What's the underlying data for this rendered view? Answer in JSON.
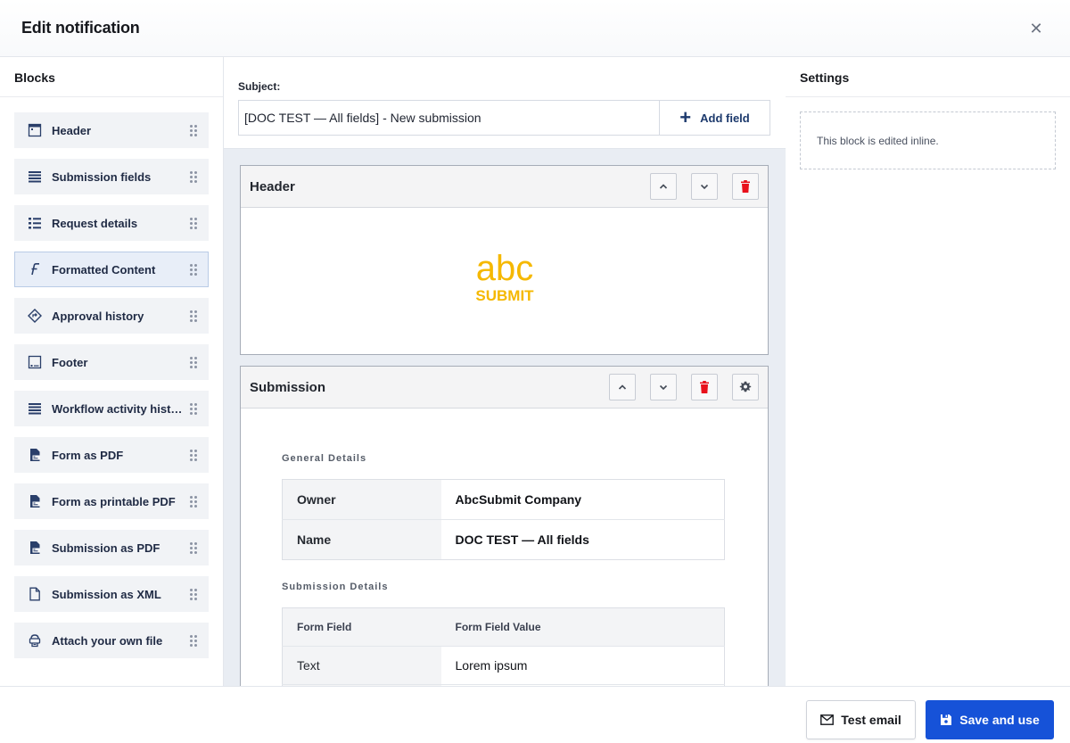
{
  "window": {
    "title": "Edit notification",
    "close_icon": "close-icon"
  },
  "blocks_panel": {
    "title": "Blocks",
    "items": [
      {
        "label": "Header",
        "icon": "header-icon"
      },
      {
        "label": "Submission fields",
        "icon": "list-lines-icon"
      },
      {
        "label": "Request details",
        "icon": "bullet-list-icon"
      },
      {
        "label": "Formatted Content",
        "icon": "formatted-text-icon",
        "active": true
      },
      {
        "label": "Approval history",
        "icon": "approval-diamond-icon"
      },
      {
        "label": "Footer",
        "icon": "footer-icon"
      },
      {
        "label": "Workflow activity history",
        "icon": "list-lines-icon"
      },
      {
        "label": "Form as PDF",
        "icon": "pdf-icon"
      },
      {
        "label": "Form as printable PDF",
        "icon": "pdf-icon"
      },
      {
        "label": "Submission as PDF",
        "icon": "pdf-icon"
      },
      {
        "label": "Submission as XML",
        "icon": "file-icon"
      },
      {
        "label": "Attach your own file",
        "icon": "attach-file-icon"
      }
    ]
  },
  "subject": {
    "label": "Subject:",
    "value": "[DOC TEST — All fields] - New submission",
    "add_field_label": "Add field"
  },
  "canvas": {
    "header_block": {
      "title": "Header",
      "logo_text_top": "abc",
      "logo_text_bottom": "SUBMIT",
      "logo_color": "#F5B800"
    },
    "submission_block": {
      "title": "Submission",
      "general_title": "General Details",
      "general_rows": [
        {
          "key": "Owner",
          "value": "AbcSubmit Company"
        },
        {
          "key": "Name",
          "value": "DOC TEST — All fields"
        }
      ],
      "details_title": "Submission Details",
      "details_header": {
        "col1": "Form Field",
        "col2": "Form Field Value"
      },
      "details_rows": [
        {
          "key": "Text",
          "value": "Lorem ipsum"
        }
      ]
    }
  },
  "settings_panel": {
    "title": "Settings",
    "message": "This block is edited inline."
  },
  "footer": {
    "test_email_label": "Test email",
    "save_label": "Save and use"
  },
  "colors": {
    "primary": "#1652D8",
    "delete": "#E8101B",
    "logo": "#F5B800"
  }
}
